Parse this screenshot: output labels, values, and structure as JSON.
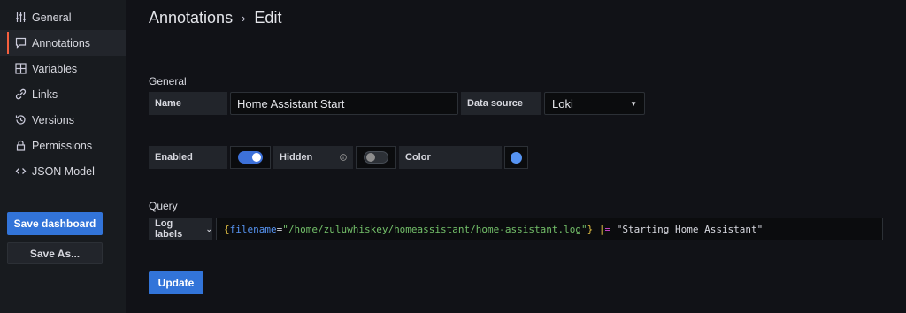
{
  "sidebar": {
    "items": [
      {
        "label": "General",
        "icon": "sliders-icon"
      },
      {
        "label": "Annotations",
        "icon": "comment-icon"
      },
      {
        "label": "Variables",
        "icon": "calculator-icon"
      },
      {
        "label": "Links",
        "icon": "link-icon"
      },
      {
        "label": "Versions",
        "icon": "history-icon"
      },
      {
        "label": "Permissions",
        "icon": "lock-icon"
      },
      {
        "label": "JSON Model",
        "icon": "code-icon"
      }
    ],
    "active": "Annotations",
    "save_label": "Save dashboard",
    "save_as_label": "Save As..."
  },
  "header": {
    "crumb": "Annotations",
    "separator": "›",
    "current": "Edit"
  },
  "general": {
    "section_label": "General",
    "name_label": "Name",
    "name_value": "Home Assistant Start",
    "datasource_label": "Data source",
    "datasource_value": "Loki",
    "enabled_label": "Enabled",
    "enabled": true,
    "hidden_label": "Hidden",
    "hidden": false,
    "color_label": "Color",
    "color_value": "#5794f2"
  },
  "query": {
    "section_label": "Query",
    "log_labels_label": "Log labels",
    "tokens": {
      "open_brace": "{",
      "key": "filename",
      "eq": "=",
      "value": "\"/home/zuluwhiskey/homeassistant/home-assistant.log\"",
      "close_brace": "}",
      "space": " ",
      "pipe": "|",
      "pipe_op": "=",
      "filter": " \"Starting Home Assistant\""
    }
  },
  "actions": {
    "update_label": "Update"
  },
  "colors": {
    "accent": "#3274d9",
    "active_marker": "#f55f3e",
    "switch_on": "#3d71d9"
  }
}
